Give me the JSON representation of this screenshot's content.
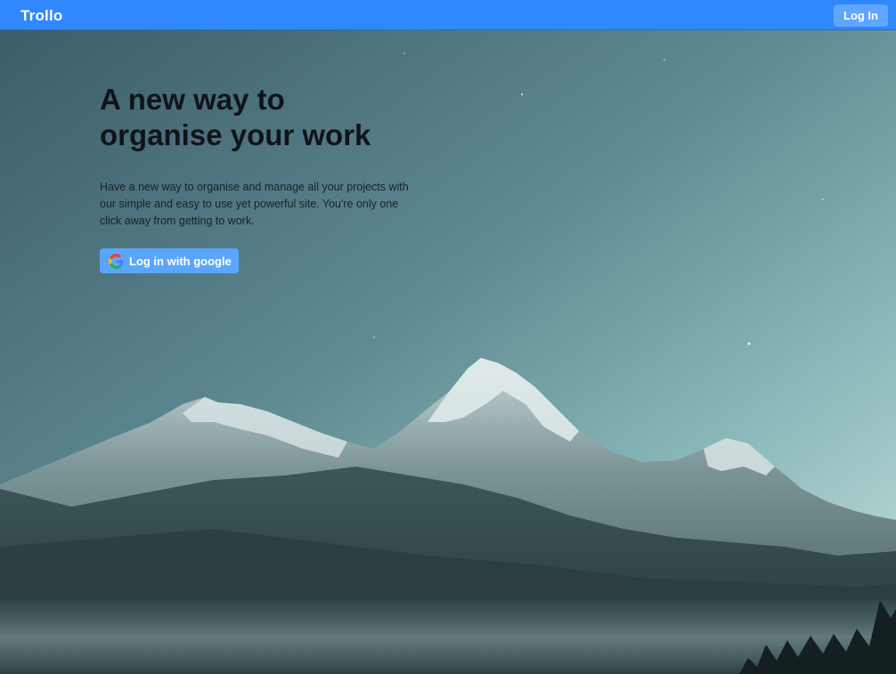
{
  "navbar": {
    "brand": "Trollo",
    "login_label": "Log In"
  },
  "hero": {
    "title_line1": "A new way to",
    "title_line2": "organise your work",
    "description": "Have a new way to organise and manage all your projects with our simple and easy to use yet powerful site. You're only one click away from getting to work.",
    "google_button_label": "Log in with google",
    "google_icon": "google-icon"
  },
  "colors": {
    "navbar": "#2f89fc",
    "button": "#5aa6ff"
  }
}
